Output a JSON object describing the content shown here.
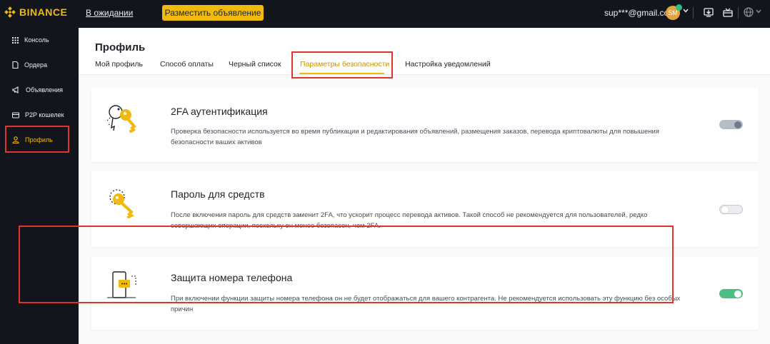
{
  "brand": {
    "name": "BINANCE",
    "accent": "#f0b90b"
  },
  "topbar": {
    "pending_link": "В ожидании",
    "post_ad_button": "Разместить объявление",
    "user_email": "sup***@gmail.com",
    "avatar_initials": "SM"
  },
  "sidebar": {
    "items": [
      {
        "label": "Консоль",
        "icon": "grid-icon"
      },
      {
        "label": "Ордера",
        "icon": "document-icon"
      },
      {
        "label": "Объявления",
        "icon": "megaphone-icon"
      },
      {
        "label": "P2P кошелек",
        "icon": "wallet-icon"
      },
      {
        "label": "Профиль",
        "icon": "user-icon",
        "active": true
      }
    ]
  },
  "page": {
    "title": "Профиль",
    "tabs": [
      {
        "label": "Мой профиль"
      },
      {
        "label": "Способ оплаты"
      },
      {
        "label": "Черный список"
      },
      {
        "label": "Параметры безопасности",
        "active": true
      },
      {
        "label": "Настройка уведомлений"
      }
    ]
  },
  "security": [
    {
      "title": "2FA аутентификация",
      "description": "Проверка безопасности используется во время публикации и редактирования объявлений, размещения заказов, перевода криптовалюты для повышения безопасности ваших активов",
      "toggle_state": "disabled-on",
      "icon": "keys-icon"
    },
    {
      "title": "Пароль для средств",
      "description": "После включения пароль для средств заменит 2FA, что ускорит процесс перевода активов. Такой способ не рекомендуется для пользователей, редко совершающих операции, поскольку он менее безопасен, чем 2FA.",
      "toggle_state": "off",
      "icon": "key-icon"
    },
    {
      "title": "Защита номера телефона",
      "description": "При включении функции защиты номера телефона он не будет отображаться для вашего контрагента. Не рекомендуется использовать эту функцию без особых причин",
      "toggle_state": "on",
      "icon": "phone-message-icon"
    }
  ],
  "colors": {
    "highlight": "#e0352b",
    "toggle_on": "#4dbd84",
    "topbar": "#12161c"
  }
}
